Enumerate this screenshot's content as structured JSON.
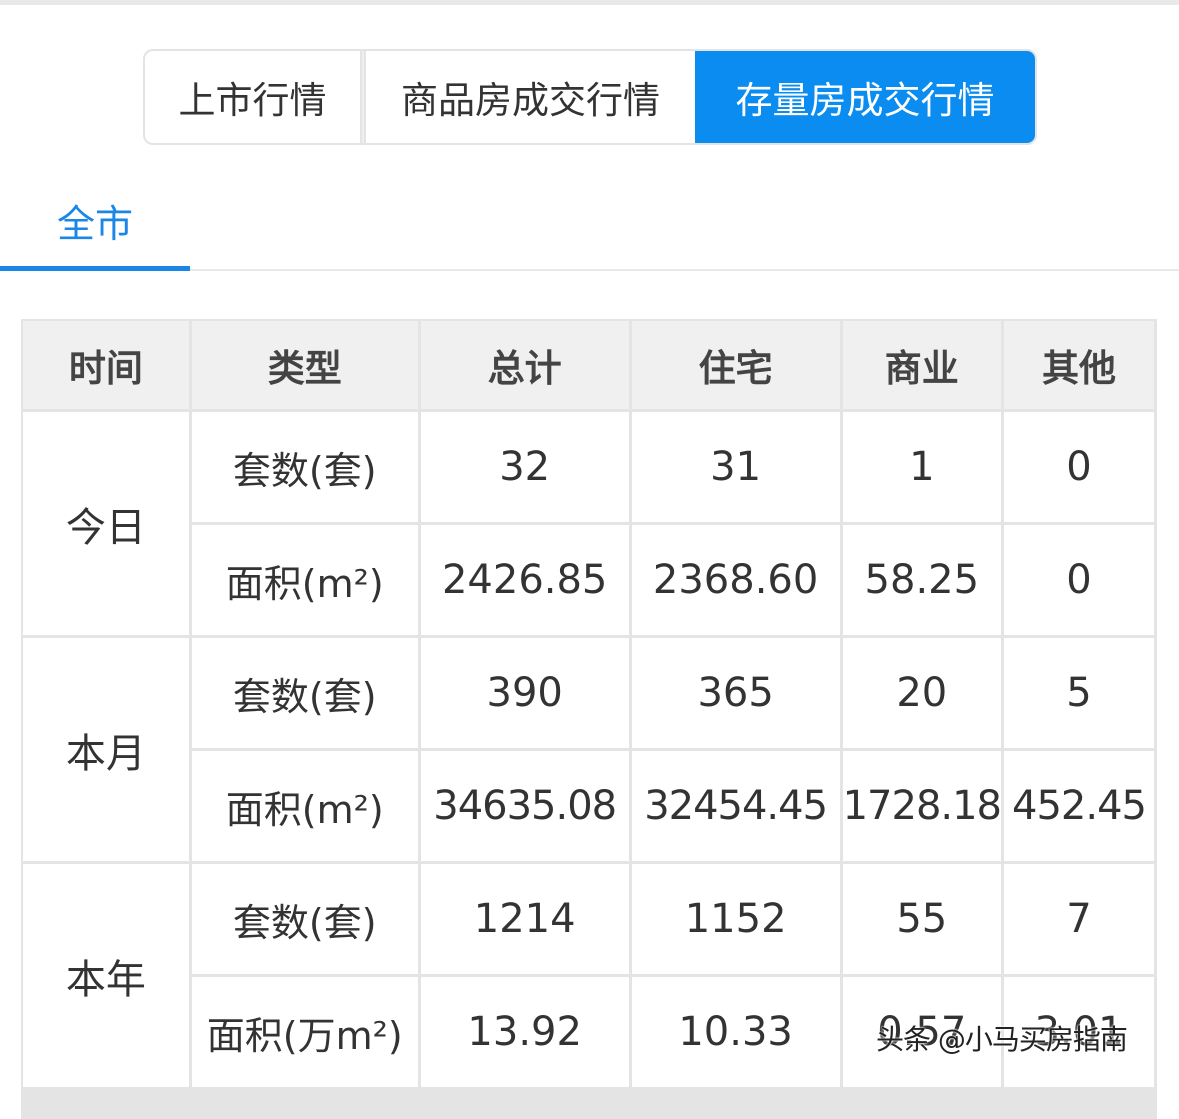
{
  "segmented_tabs": {
    "listing": "上市行情",
    "new_home": "商品房成交行情",
    "resale": "存量房成交行情",
    "active": "resale",
    "active_color": "#0a8cf0"
  },
  "region_tabs": {
    "all_city": "全市",
    "active_color": "#1a86e6"
  },
  "table": {
    "headers": [
      "时间",
      "类型",
      "总计",
      "住宅",
      "商业",
      "其他"
    ],
    "groups": [
      {
        "period": "今日",
        "rows": [
          {
            "type": "套数(套)",
            "total": "32",
            "residential": "31",
            "commercial": "1",
            "other": "0"
          },
          {
            "type": "面积(m²)",
            "total": "2426.85",
            "residential": "2368.60",
            "commercial": "58.25",
            "other": "0"
          }
        ]
      },
      {
        "period": "本月",
        "rows": [
          {
            "type": "套数(套)",
            "total": "390",
            "residential": "365",
            "commercial": "20",
            "other": "5"
          },
          {
            "type": "面积(m²)",
            "total": "34635.08",
            "residential": "32454.45",
            "commercial": "1728.18",
            "other": "452.45"
          }
        ]
      },
      {
        "period": "本年",
        "rows": [
          {
            "type": "套数(套)",
            "total": "1214",
            "residential": "1152",
            "commercial": "55",
            "other": "7"
          },
          {
            "type": "面积(万m²)",
            "total": "13.92",
            "residential": "10.33",
            "commercial": "0.57",
            "other": "3.01"
          }
        ]
      }
    ]
  },
  "watermark": "头条 @小马买房指南"
}
